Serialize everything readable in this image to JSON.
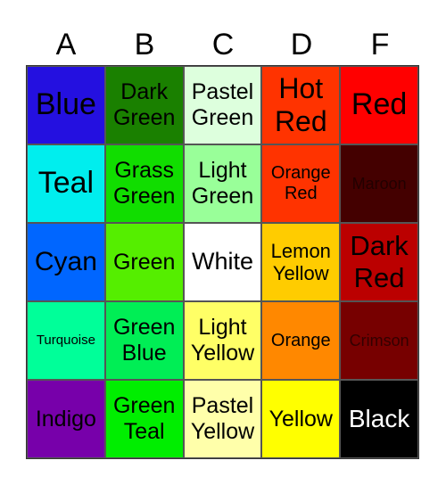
{
  "header": [
    "A",
    "B",
    "C",
    "D",
    "F"
  ],
  "cells": [
    [
      {
        "text": "Blue",
        "bg": "#2410e0",
        "size": 34
      },
      {
        "text": "Dark Green",
        "bg": "#1a8000",
        "size": 25
      },
      {
        "text": "Pastel Green",
        "bg": "#ddffdd",
        "size": 25
      },
      {
        "text": "Hot Red",
        "bg": "#ff3300",
        "size": 32
      },
      {
        "text": "Red",
        "bg": "#ff0000",
        "size": 34
      }
    ],
    [
      {
        "text": "Teal",
        "bg": "#00eeee",
        "size": 34
      },
      {
        "text": "Grass Green",
        "bg": "#11dd00",
        "size": 25
      },
      {
        "text": "Light Green",
        "bg": "#99ff99",
        "size": 25
      },
      {
        "text": "Orange Red",
        "bg": "#ff3300",
        "size": 20
      },
      {
        "text": "Maroon",
        "bg": "#440000",
        "size": 18,
        "color": "#220000"
      }
    ],
    [
      {
        "text": "Cyan",
        "bg": "#0066ff",
        "size": 30
      },
      {
        "text": "Green",
        "bg": "#55ee00",
        "size": 25
      },
      {
        "text": "White",
        "bg": "#ffffff",
        "size": 27
      },
      {
        "text": "Lemon Yellow",
        "bg": "#ffcc00",
        "size": 22
      },
      {
        "text": "Dark Red",
        "bg": "#bb0000",
        "size": 31
      }
    ],
    [
      {
        "text": "Turquoise",
        "bg": "#00ff99",
        "size": 15
      },
      {
        "text": "Green Blue",
        "bg": "#00ee55",
        "size": 25
      },
      {
        "text": "Light Yellow",
        "bg": "#ffff66",
        "size": 25
      },
      {
        "text": "Orange",
        "bg": "#ff8800",
        "size": 20
      },
      {
        "text": "Crimson",
        "bg": "#770000",
        "size": 18,
        "color": "#330000"
      }
    ],
    [
      {
        "text": "Indigo",
        "bg": "#7700aa",
        "size": 25
      },
      {
        "text": "Green Teal",
        "bg": "#00ee00",
        "size": 25
      },
      {
        "text": "Pastel Yellow",
        "bg": "#ffffaa",
        "size": 25
      },
      {
        "text": "Yellow",
        "bg": "#ffff00",
        "size": 25
      },
      {
        "text": "Black",
        "bg": "#000000",
        "size": 28,
        "color": "#ffffff"
      }
    ]
  ]
}
